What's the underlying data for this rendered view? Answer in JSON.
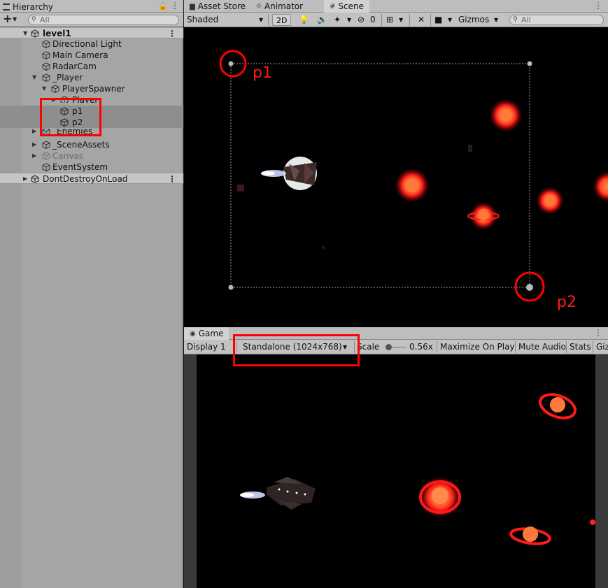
{
  "hierarchy": {
    "tab_label": "Hierarchy",
    "add_label": "+",
    "search_placeholder": "All",
    "items": [
      {
        "label": "level1"
      },
      {
        "label": "Directional Light"
      },
      {
        "label": "Main Camera"
      },
      {
        "label": "RadarCam"
      },
      {
        "label": "_Player"
      },
      {
        "label": "PlayerSpawner"
      },
      {
        "label": "Player"
      },
      {
        "label": "p1"
      },
      {
        "label": "p2"
      },
      {
        "label": "_Enemies"
      },
      {
        "label": "_SceneAssets"
      },
      {
        "label": "Canvas"
      },
      {
        "label": "EventSystem"
      },
      {
        "label": "DontDestroyOnLoad"
      }
    ]
  },
  "scene_panel": {
    "tabs": [
      {
        "label": "Asset Store",
        "icon": "store-icon"
      },
      {
        "label": "Animator",
        "icon": "animator-icon"
      },
      {
        "label": "Scene",
        "icon": "grid-icon"
      }
    ],
    "toolbar": {
      "shading_mode": "Shaded",
      "mode_2d": "2D",
      "hidden_count": "0",
      "gizmos_label": "Gizmos",
      "search_placeholder": "All"
    },
    "annotations": {
      "p1": "p1",
      "p2": "p2"
    }
  },
  "game_panel": {
    "tab_label": "Game",
    "display": "Display 1",
    "resolution": "Standalone (1024x768)",
    "scale_label": "Scale",
    "scale_value": "0.56x",
    "maximize_label": "Maximize On Play",
    "mute_label": "Mute Audio",
    "stats_label": "Stats",
    "gizmos_label": "Giz"
  },
  "colors": {
    "panel_bg": "#a5a5a5",
    "toolbar_bg": "#c2c2c2",
    "annotation_red": "#ff0000",
    "planet_red": "#ff1a1a",
    "planet_core": "#ff7a3a"
  }
}
